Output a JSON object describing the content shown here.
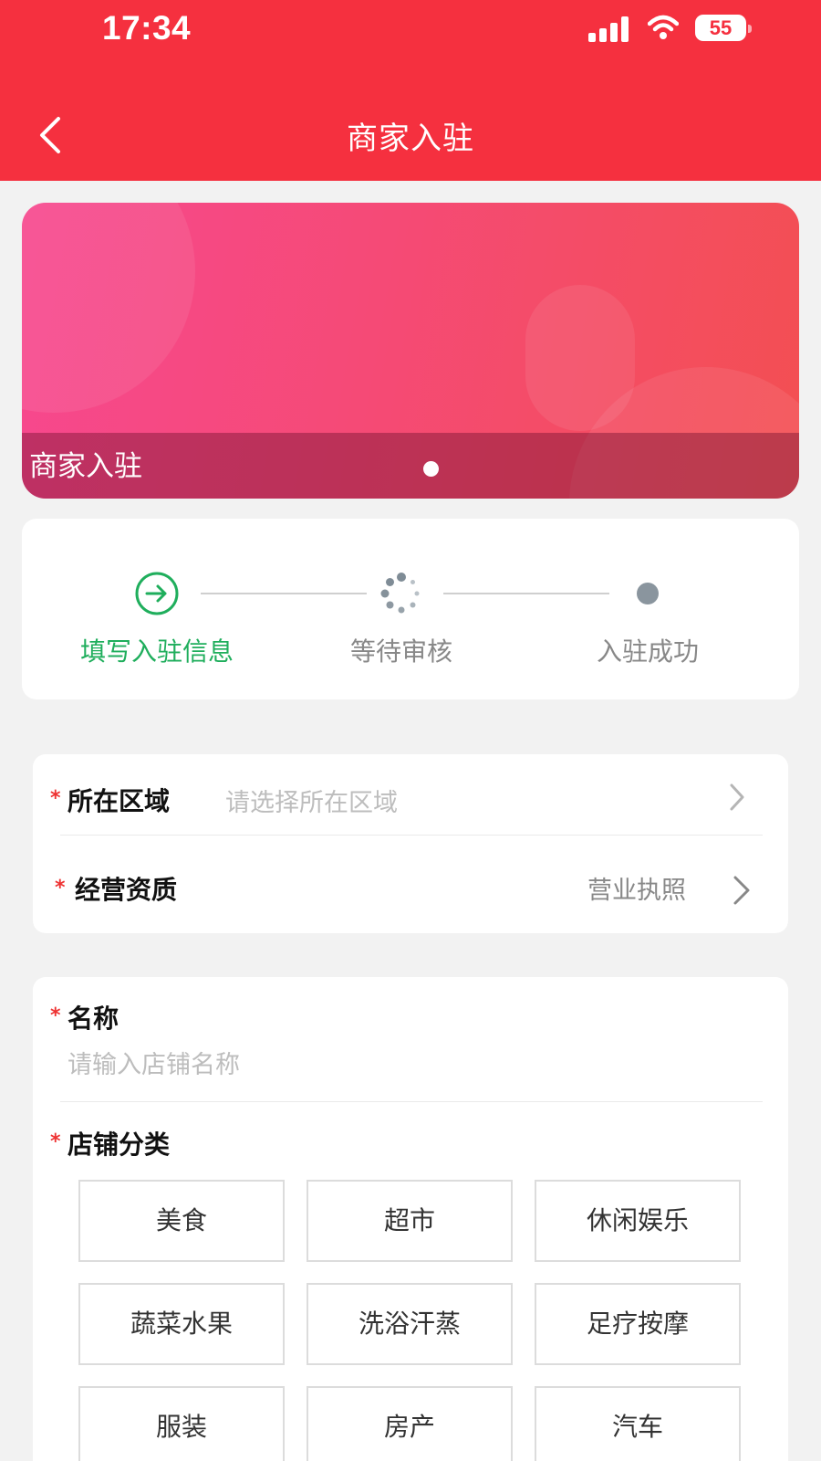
{
  "status_bar": {
    "time": "17:34",
    "battery": "55"
  },
  "nav": {
    "title": "商家入驻"
  },
  "banner": {
    "caption": "商家入驻"
  },
  "steps": [
    {
      "label": "填写入驻信息",
      "state": "active"
    },
    {
      "label": "等待审核",
      "state": "pending"
    },
    {
      "label": "入驻成功",
      "state": "todo"
    }
  ],
  "colors": {
    "header": "#f5303f",
    "active_step": "#1fae5c",
    "required": "#e33333"
  },
  "qualification_card": {
    "region": {
      "label": "所在区域",
      "placeholder": "请选择所在区域"
    },
    "qualification": {
      "label": "经营资质",
      "value": "营业执照"
    }
  },
  "shop_card": {
    "name": {
      "label": "名称",
      "placeholder": "请输入店铺名称"
    },
    "category": {
      "label": "店铺分类",
      "options": [
        "美食",
        "超市",
        "休闲娱乐",
        "蔬菜水果",
        "洗浴汗蒸",
        "足疗按摩",
        "服装",
        "房产",
        "汽车"
      ]
    }
  }
}
